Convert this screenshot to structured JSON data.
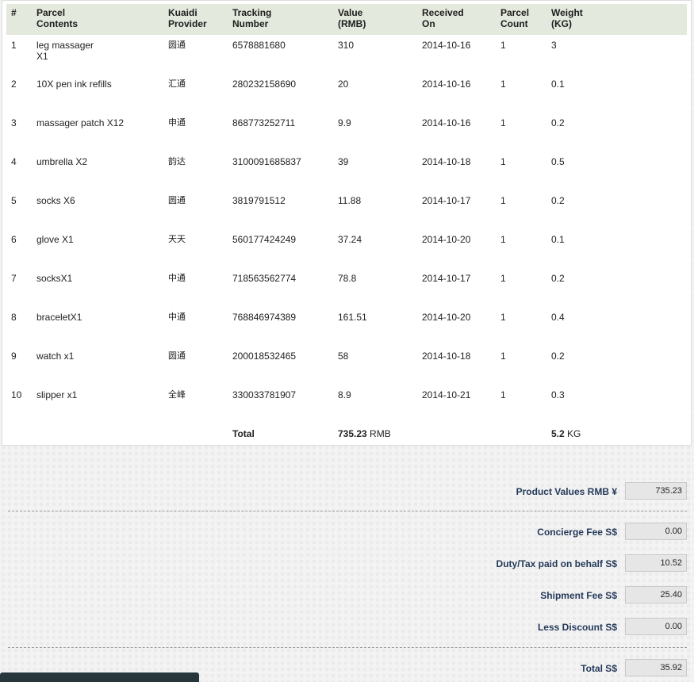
{
  "table": {
    "headers": [
      {
        "l1": "#",
        "l2": ""
      },
      {
        "l1": "Parcel",
        "l2": "Contents"
      },
      {
        "l1": "Kuaidi",
        "l2": "Provider"
      },
      {
        "l1": "Tracking",
        "l2": "Number"
      },
      {
        "l1": "Value",
        "l2": "(RMB)"
      },
      {
        "l1": "Received",
        "l2": "On"
      },
      {
        "l1": "Parcel",
        "l2": "Count"
      },
      {
        "l1": "Weight",
        "l2": "(KG)"
      }
    ],
    "rows": [
      {
        "num": "1",
        "contents": "leg massager",
        "contents2": "X1",
        "provider": "圆通",
        "tracking": "6578881680",
        "value": "310",
        "received": "2014-10-16",
        "count": "1",
        "weight": "3"
      },
      {
        "num": "2",
        "contents": "10X pen ink refills",
        "contents2": "",
        "provider": "汇通",
        "tracking": "280232158690",
        "value": "20",
        "received": "2014-10-16",
        "count": "1",
        "weight": "0.1"
      },
      {
        "num": "3",
        "contents": "massager patch X12",
        "contents2": "",
        "provider": "申通",
        "tracking": "868773252711",
        "value": "9.9",
        "received": "2014-10-16",
        "count": "1",
        "weight": "0.2"
      },
      {
        "num": "4",
        "contents": "umbrella X2",
        "contents2": "",
        "provider": "韵达",
        "tracking": "3100091685837",
        "value": "39",
        "received": "2014-10-18",
        "count": "1",
        "weight": "0.5"
      },
      {
        "num": "5",
        "contents": "socks X6",
        "contents2": "",
        "provider": "圆通",
        "tracking": "3819791512",
        "value": "11.88",
        "received": "2014-10-17",
        "count": "1",
        "weight": "0.2"
      },
      {
        "num": "6",
        "contents": "glove X1",
        "contents2": "",
        "provider": "天天",
        "tracking": "560177424249",
        "value": "37.24",
        "received": "2014-10-20",
        "count": "1",
        "weight": "0.1"
      },
      {
        "num": "7",
        "contents": "socksX1",
        "contents2": "",
        "provider": "中通",
        "tracking": "718563562774",
        "value": "78.8",
        "received": "2014-10-17",
        "count": "1",
        "weight": "0.2"
      },
      {
        "num": "8",
        "contents": "braceletX1",
        "contents2": "",
        "provider": "中通",
        "tracking": "768846974389",
        "value": "161.51",
        "received": "2014-10-20",
        "count": "1",
        "weight": "0.4"
      },
      {
        "num": "9",
        "contents": "watch x1",
        "contents2": "",
        "provider": "圆通",
        "tracking": "200018532465",
        "value": "58",
        "received": "2014-10-18",
        "count": "1",
        "weight": "0.2"
      },
      {
        "num": "10",
        "contents": "slipper x1",
        "contents2": "",
        "provider": "全峰",
        "tracking": "330033781907",
        "value": "8.9",
        "received": "2014-10-21",
        "count": "1",
        "weight": "0.3"
      }
    ],
    "footer": {
      "label": "Total",
      "value": "735.23",
      "value_unit": "RMB",
      "weight": "5.2",
      "weight_unit": "KG"
    }
  },
  "summary": {
    "product_values": {
      "label": "Product Values RMB ¥",
      "value": "735.23"
    },
    "concierge_fee": {
      "label": "Concierge Fee S$",
      "value": "0.00"
    },
    "duty_tax": {
      "label": "Duty/Tax paid on behalf S$",
      "value": "10.52"
    },
    "shipment_fee": {
      "label": "Shipment Fee S$",
      "value": "25.40"
    },
    "discount": {
      "label": "Less Discount S$",
      "value": "0.00"
    },
    "total": {
      "label": "Total S$",
      "value": "35.92"
    }
  },
  "colors": {
    "header_bg": "#e3e9dc",
    "label_color": "#243a5a",
    "bottom_bar": "#26363a"
  }
}
